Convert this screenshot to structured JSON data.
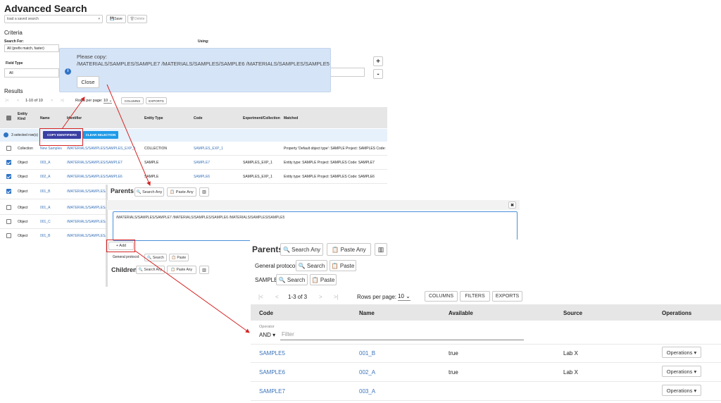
{
  "page": {
    "title": "Advanced Search"
  },
  "toolbar": {
    "saved_search_placeholder": "load a saved search",
    "save": "Save",
    "delete": "Delete"
  },
  "criteria": {
    "title": "Criteria",
    "search_for_label": "Search For:",
    "search_for_value": "All (prefix match, faster)",
    "using_label": "Using:",
    "field_type_label": "Field Type",
    "field_type_value": "All",
    "add": "+",
    "remove": "-"
  },
  "copy_dialog": {
    "title": "Please copy:",
    "text": "/MATERIALS/SAMPLES/SAMPLE7 /MATERIALS/SAMPLES/SAMPLE6 /MATERIALS/SAMPLES/SAMPLE5",
    "close": "Close",
    "info_icon": "i"
  },
  "results": {
    "title": "Results",
    "range": "1-10 of 10",
    "rows_per_page_label": "Rows per page:",
    "rows_per_page_value": "10",
    "columns": "COLUMNS",
    "exports": "EXPORTS",
    "headers": [
      "Entity Kind",
      "Name",
      "Identifier",
      "Entity Type",
      "Code",
      "Experiment/Collection",
      "Matched"
    ],
    "selection_text": "3 selected row(s)",
    "copy_identifiers": "COPY IDENTIFIERS",
    "clear_selection": "CLEAR SELECTION",
    "rows": [
      {
        "kind": "Collection",
        "name": "New Samples",
        "identifier": "/MATERIALS/SAMPLES/SAMPLES_EXP_1",
        "type": "COLLECTION",
        "code": "SAMPLES_EXP_1",
        "experiment": "",
        "matched": "Property 'Default object type': SAMPLE Project: SAMPLES Code:",
        "checked": false
      },
      {
        "kind": "Object",
        "name": "003_A",
        "identifier": "/MATERIALS/SAMPLES/SAMPLE7",
        "type": "SAMPLE",
        "code": "SAMPLE7",
        "experiment": "SAMPLES_EXP_1",
        "matched": "Entity type: SAMPLE Project: SAMPLES Code: SAMPLE7",
        "checked": true
      },
      {
        "kind": "Object",
        "name": "002_A",
        "identifier": "/MATERIALS/SAMPLES/SAMPLE6",
        "type": "SAMPLE",
        "code": "SAMPLE6",
        "experiment": "SAMPLES_EXP_1",
        "matched": "Entity type: SAMPLE Project: SAMPLES Code: SAMPLE6",
        "checked": true
      },
      {
        "kind": "Object",
        "name": "001_B",
        "identifier": "/MATERIALS/SAMPLES/",
        "type": "",
        "code": "",
        "experiment": "",
        "matched": "",
        "checked": true
      },
      {
        "kind": "Object",
        "name": "001_A",
        "identifier": "/MATERIALS/SAMPLES/",
        "type": "",
        "code": "",
        "experiment": "",
        "matched": "",
        "checked": false
      },
      {
        "kind": "Object",
        "name": "001_C",
        "identifier": "/MATERIALS/SAMPLES/",
        "type": "",
        "code": "",
        "experiment": "",
        "matched": "",
        "checked": false
      },
      {
        "kind": "Object",
        "name": "001_B",
        "identifier": "/MATERIALS/SAMPLES/",
        "type": "",
        "code": "",
        "experiment": "",
        "matched": "",
        "checked": false
      }
    ]
  },
  "paste_panel": {
    "parents_title": "Parents",
    "search_any": "Search Any",
    "paste_any": "Paste Any",
    "text": "/MATERIALS/SAMPLES/SAMPLE7 /MATERIALS/SAMPLES/SAMPLE6 /MATERIALS/SAMPLES/SAMPLE5",
    "add": "+ Add",
    "general_protocol": "General protocol:",
    "search": "Search",
    "paste": "Paste",
    "children_title": "Children",
    "close_icon": "✖"
  },
  "parents_result": {
    "title": "Parents",
    "search_any": "Search Any",
    "paste_any": "Paste Any",
    "general_protocol": "General protocol:",
    "sample_label": "SAMPLE:",
    "search": "Search",
    "paste": "Paste",
    "range": "1-3 of 3",
    "rows_per_page_label": "Rows per page:",
    "rows_per_page_value": "10",
    "columns": "COLUMNS",
    "filters": "FILTERS",
    "exports": "EXPORTS",
    "headers": [
      "Code",
      "Name",
      "Available",
      "Source",
      "Operations"
    ],
    "operator_label": "Operator",
    "operator_value": "AND",
    "filter_placeholder": "Filter",
    "rows": [
      {
        "code": "SAMPLE5",
        "name": "001_B",
        "available": "true",
        "source": "Lab X",
        "ops": "Operations"
      },
      {
        "code": "SAMPLE6",
        "name": "002_A",
        "available": "true",
        "source": "Lab X",
        "ops": "Operations"
      },
      {
        "code": "SAMPLE7",
        "name": "003_A",
        "available": "",
        "source": "",
        "ops": "Operations"
      }
    ]
  },
  "colors": {
    "accent": "#3a73b9",
    "annotation": "#d62424",
    "dialog_bg": "#d6e4f7",
    "selection_bg": "#e7f1fb"
  }
}
